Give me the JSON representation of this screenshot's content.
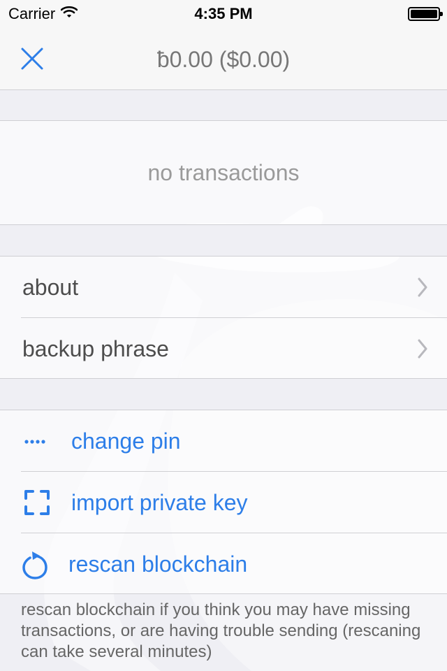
{
  "status_bar": {
    "carrier": "Carrier",
    "time": "4:35 PM"
  },
  "header": {
    "balance": "ƀ0.00 ($0.00)"
  },
  "transactions": {
    "empty_label": "no transactions"
  },
  "menu": {
    "about": "about",
    "backup_phrase": "backup phrase"
  },
  "actions": {
    "change_pin": "change pin",
    "import_private_key": "import private key",
    "rescan_blockchain": "rescan blockchain"
  },
  "footer": {
    "note": "rescan blockchain if you think you may have missing transactions, or are having trouble sending (rescaning can take several minutes)"
  },
  "colors": {
    "accent": "#2d7ee8",
    "background": "#efeff4"
  }
}
